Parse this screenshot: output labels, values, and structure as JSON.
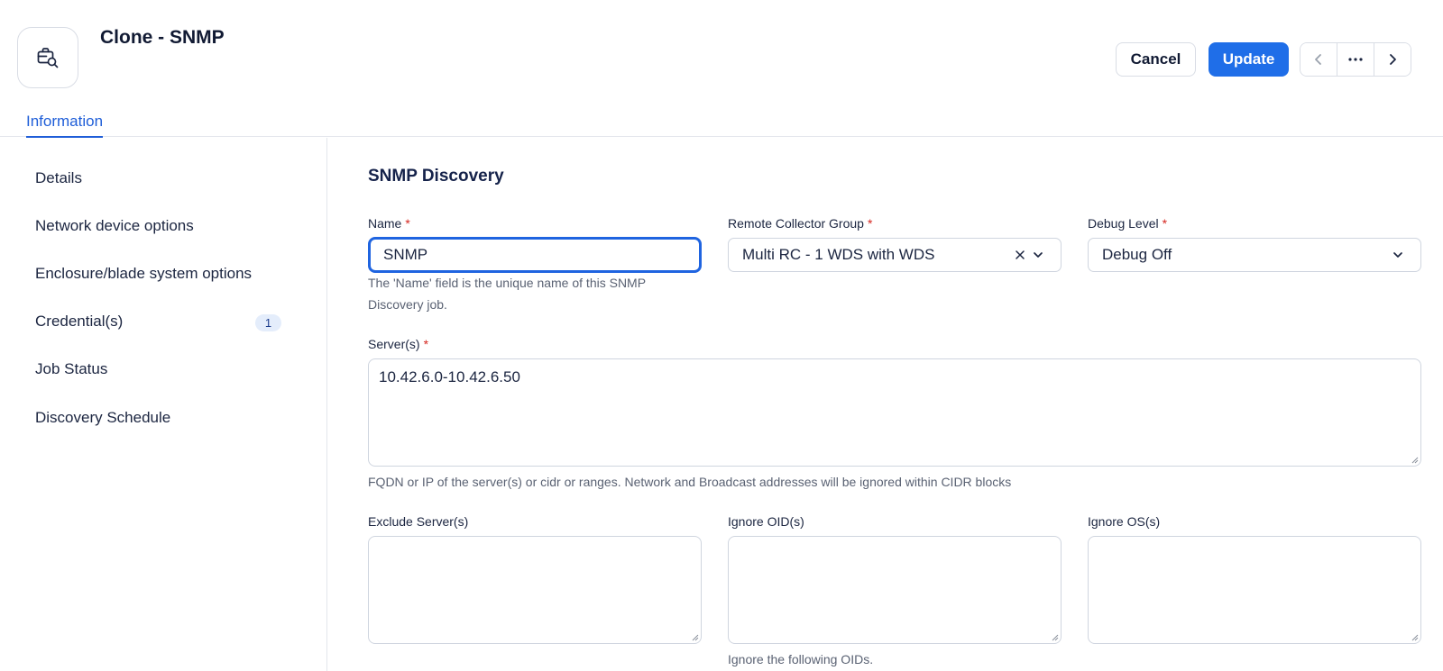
{
  "header": {
    "title": "Clone - SNMP",
    "record_icon": "briefcase-search-icon",
    "cancel_label": "Cancel",
    "update_label": "Update",
    "nav": {
      "prev_icon": "chevron-left-icon",
      "more_icon": "more-horizontal-icon",
      "next_icon": "chevron-right-icon"
    },
    "accent_color": "#1f6ee8"
  },
  "tabs": [
    {
      "label": "Information",
      "active": true
    }
  ],
  "sidebar": {
    "items": [
      {
        "label": "Details"
      },
      {
        "label": "Network device options"
      },
      {
        "label": "Enclosure/blade system options"
      },
      {
        "label": "Credential(s)",
        "badge": "1"
      },
      {
        "label": "Job Status"
      },
      {
        "label": "Discovery Schedule"
      }
    ]
  },
  "main": {
    "section_title": "SNMP Discovery",
    "required_marker": "*",
    "name": {
      "label": "Name",
      "value": "SNMP",
      "help": "The 'Name' field is the unique name of this SNMP Discovery job."
    },
    "remote_collector_group": {
      "label": "Remote Collector Group",
      "value": "Multi RC - 1 WDS with WDS"
    },
    "debug_level": {
      "label": "Debug Level",
      "value": "Debug Off"
    },
    "servers": {
      "label": "Server(s)",
      "value": "10.42.6.0-10.42.6.50",
      "help": "FQDN or IP of the server(s) or cidr or ranges. Network and Broadcast addresses will be ignored within CIDR blocks"
    },
    "exclude_servers": {
      "label": "Exclude Server(s)",
      "value": ""
    },
    "ignore_oids": {
      "label": "Ignore OID(s)",
      "value": "",
      "help": "Ignore the following OIDs."
    },
    "ignore_os": {
      "label": "Ignore OS(s)",
      "value": ""
    }
  }
}
